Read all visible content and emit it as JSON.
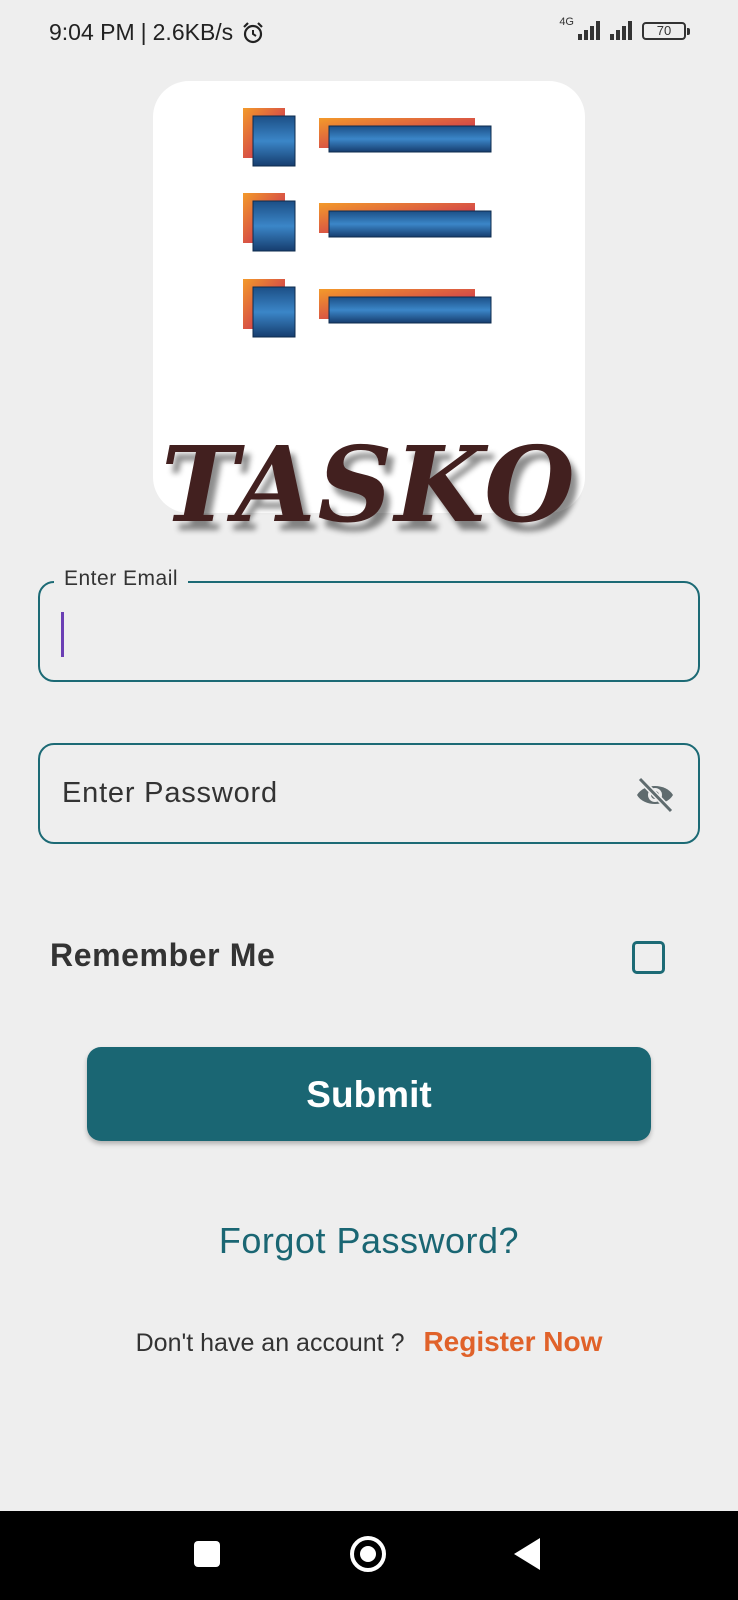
{
  "status_bar": {
    "time": "9:04 PM",
    "separator": "|",
    "net_speed": "2.6KB/s",
    "network_type": "4G",
    "battery": "70"
  },
  "logo": {
    "text": "TASKO"
  },
  "form": {
    "email_label": "Enter Email",
    "email_value": "",
    "password_placeholder": "Enter Password",
    "remember_label": "Remember Me",
    "remember_checked": false,
    "submit_label": "Submit",
    "forgot_label": "Forgot Password?",
    "no_account_text": "Don't have an account ?",
    "register_label": "Register Now"
  },
  "colors": {
    "accent": "#1a6673",
    "link_orange": "#e0622a",
    "background": "#eeeeee"
  },
  "icons": [
    "alarm-icon",
    "eye-off-icon",
    "recent-apps-icon",
    "home-icon",
    "back-icon"
  ]
}
